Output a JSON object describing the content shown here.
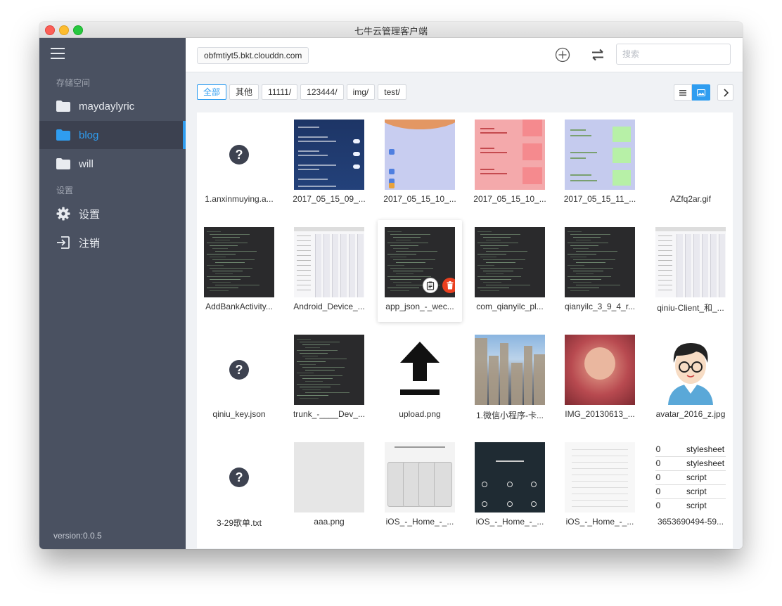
{
  "window": {
    "title": "七牛云管理客户端"
  },
  "sidebar": {
    "storage_section": "存储空间",
    "buckets": [
      {
        "label": "maydaylyric",
        "icon": "folder-icon",
        "active": false
      },
      {
        "label": "blog",
        "icon": "folder-icon",
        "active": true
      },
      {
        "label": "will",
        "icon": "folder-icon",
        "active": false
      }
    ],
    "settings_section": "设置",
    "settings_items": [
      {
        "label": "设置",
        "icon": "gear-icon"
      },
      {
        "label": "注销",
        "icon": "logout-icon"
      }
    ],
    "version": "version:0.0.5"
  },
  "topbar": {
    "domain": "obfmtiyt5.bkt.clouddn.com",
    "search_placeholder": "搜索"
  },
  "filters": [
    {
      "label": "全部",
      "active": true
    },
    {
      "label": "其他",
      "active": false
    },
    {
      "label": "11111/",
      "active": false
    },
    {
      "label": "123444/",
      "active": false
    },
    {
      "label": "img/",
      "active": false
    },
    {
      "label": "test/",
      "active": false
    }
  ],
  "view_mode": "grid",
  "files": [
    {
      "name": "1.anxinmuying.a...",
      "thumb": "unknown"
    },
    {
      "name": "2017_05_15_09_...",
      "thumb": "phone-dark"
    },
    {
      "name": "2017_05_15_10_...",
      "thumb": "lavender"
    },
    {
      "name": "2017_05_15_10_...",
      "thumb": "pink"
    },
    {
      "name": "2017_05_15_11_...",
      "thumb": "green"
    },
    {
      "name": "AZfq2ar.gif",
      "thumb": "blank"
    },
    {
      "name": "AddBankActivity...",
      "thumb": "code"
    },
    {
      "name": "Android_Device_...",
      "thumb": "table"
    },
    {
      "name": "app_json_-_wec...",
      "thumb": "code",
      "hover": true
    },
    {
      "name": "com_qianyilc_pl...",
      "thumb": "code"
    },
    {
      "name": "qianyilc_3_9_4_r...",
      "thumb": "code"
    },
    {
      "name": "qiniu-Client_和_...",
      "thumb": "table"
    },
    {
      "name": "qiniu_key.json",
      "thumb": "unknown"
    },
    {
      "name": "trunk_-____Dev_...",
      "thumb": "code"
    },
    {
      "name": "upload.png",
      "thumb": "upload"
    },
    {
      "name": "1.微信小程序-卡...",
      "thumb": "city"
    },
    {
      "name": "IMG_20130613_...",
      "thumb": "baby"
    },
    {
      "name": "avatar_2016_z.jpg",
      "thumb": "avatar"
    },
    {
      "name": "3-29歌单.txt",
      "thumb": "unknown"
    },
    {
      "name": "aaa.png",
      "thumb": "grey"
    },
    {
      "name": "iOS_-_Home_-_...",
      "thumb": "ios-phones"
    },
    {
      "name": "iOS_-_Home_-_...",
      "thumb": "ios-dark"
    },
    {
      "name": "iOS_-_Home_-_...",
      "thumb": "ios-white"
    },
    {
      "name": "3653690494-59...",
      "thumb": "css-table"
    }
  ],
  "css_table_rows": [
    {
      "num": "00",
      "type": "stylesheet"
    },
    {
      "num": "00",
      "type": "stylesheet"
    },
    {
      "num": "00",
      "type": "script"
    },
    {
      "num": "00",
      "type": "script"
    },
    {
      "num": "00",
      "type": "script"
    }
  ],
  "colors": {
    "accent": "#2f9df0",
    "sidebar_bg": "#4a5161",
    "delete": "#ea3f1f"
  }
}
